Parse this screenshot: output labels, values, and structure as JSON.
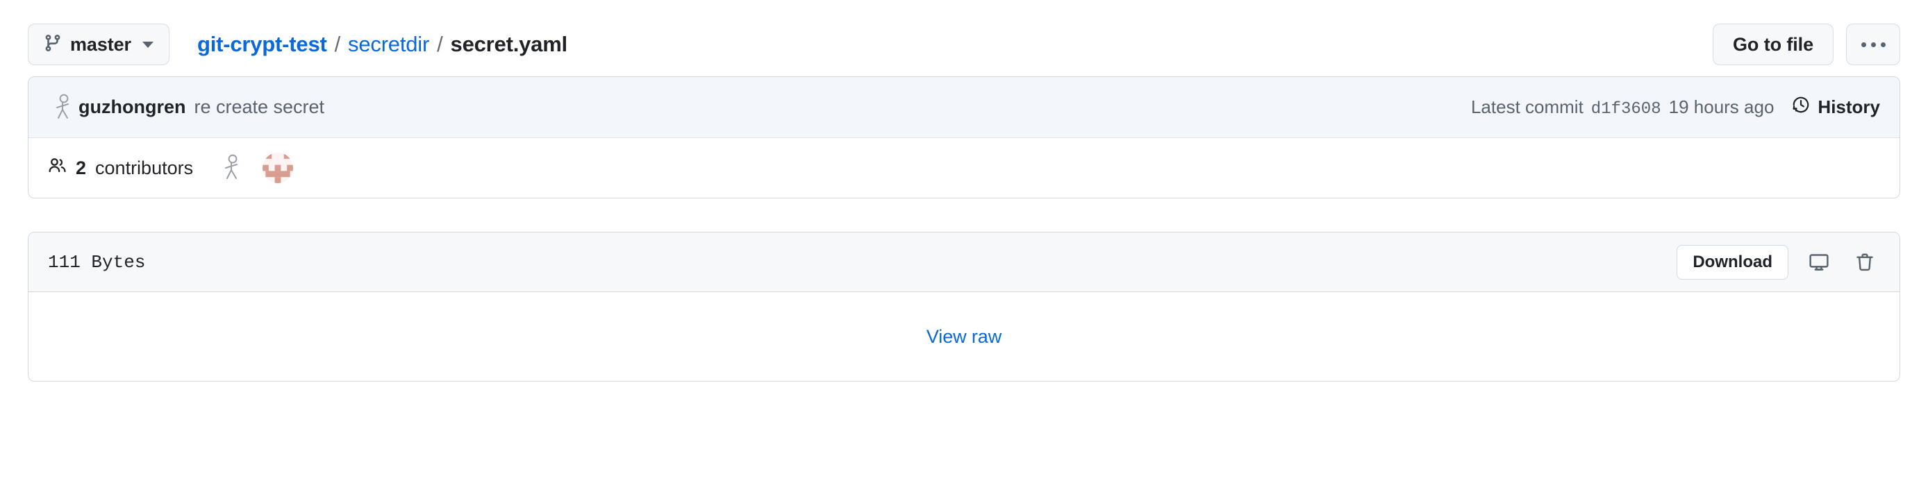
{
  "header": {
    "branch": {
      "icon": "git-branch-icon",
      "name": "master",
      "caret": "chevron-down-icon"
    },
    "breadcrumb": {
      "repo": "git-crypt-test",
      "separator": "/",
      "directory": "secretdir",
      "file": "secret.yaml"
    },
    "go_to_file_label": "Go to file",
    "more_options_label": "···"
  },
  "commit": {
    "author_avatar": "stick-figure-avatar",
    "author": "guzhongren",
    "message": "re create secret",
    "latest_commit_label": "Latest commit",
    "sha": "d1f3608",
    "relative_time": "19 hours ago",
    "history_icon": "history-clock-icon",
    "history_label": "History"
  },
  "contributors": {
    "icon": "people-icon",
    "count": "2",
    "label": "contributors",
    "avatars": [
      {
        "name": "stick-figure-avatar",
        "kind": "stick"
      },
      {
        "name": "identicon-avatar",
        "kind": "identicon"
      }
    ]
  },
  "file": {
    "size": "111 Bytes",
    "download_label": "Download",
    "open_desktop_icon": "desktop-download-icon",
    "delete_icon": "trash-icon",
    "view_raw_label": "View raw"
  },
  "colors": {
    "link_blue": "#0969da",
    "text_primary": "#1f2328",
    "text_muted": "#59636e",
    "border": "#d1d9e0",
    "commit_bg": "#f3f7fc",
    "head_bg": "#f6f8fa",
    "identicon": "#d99d8f"
  }
}
